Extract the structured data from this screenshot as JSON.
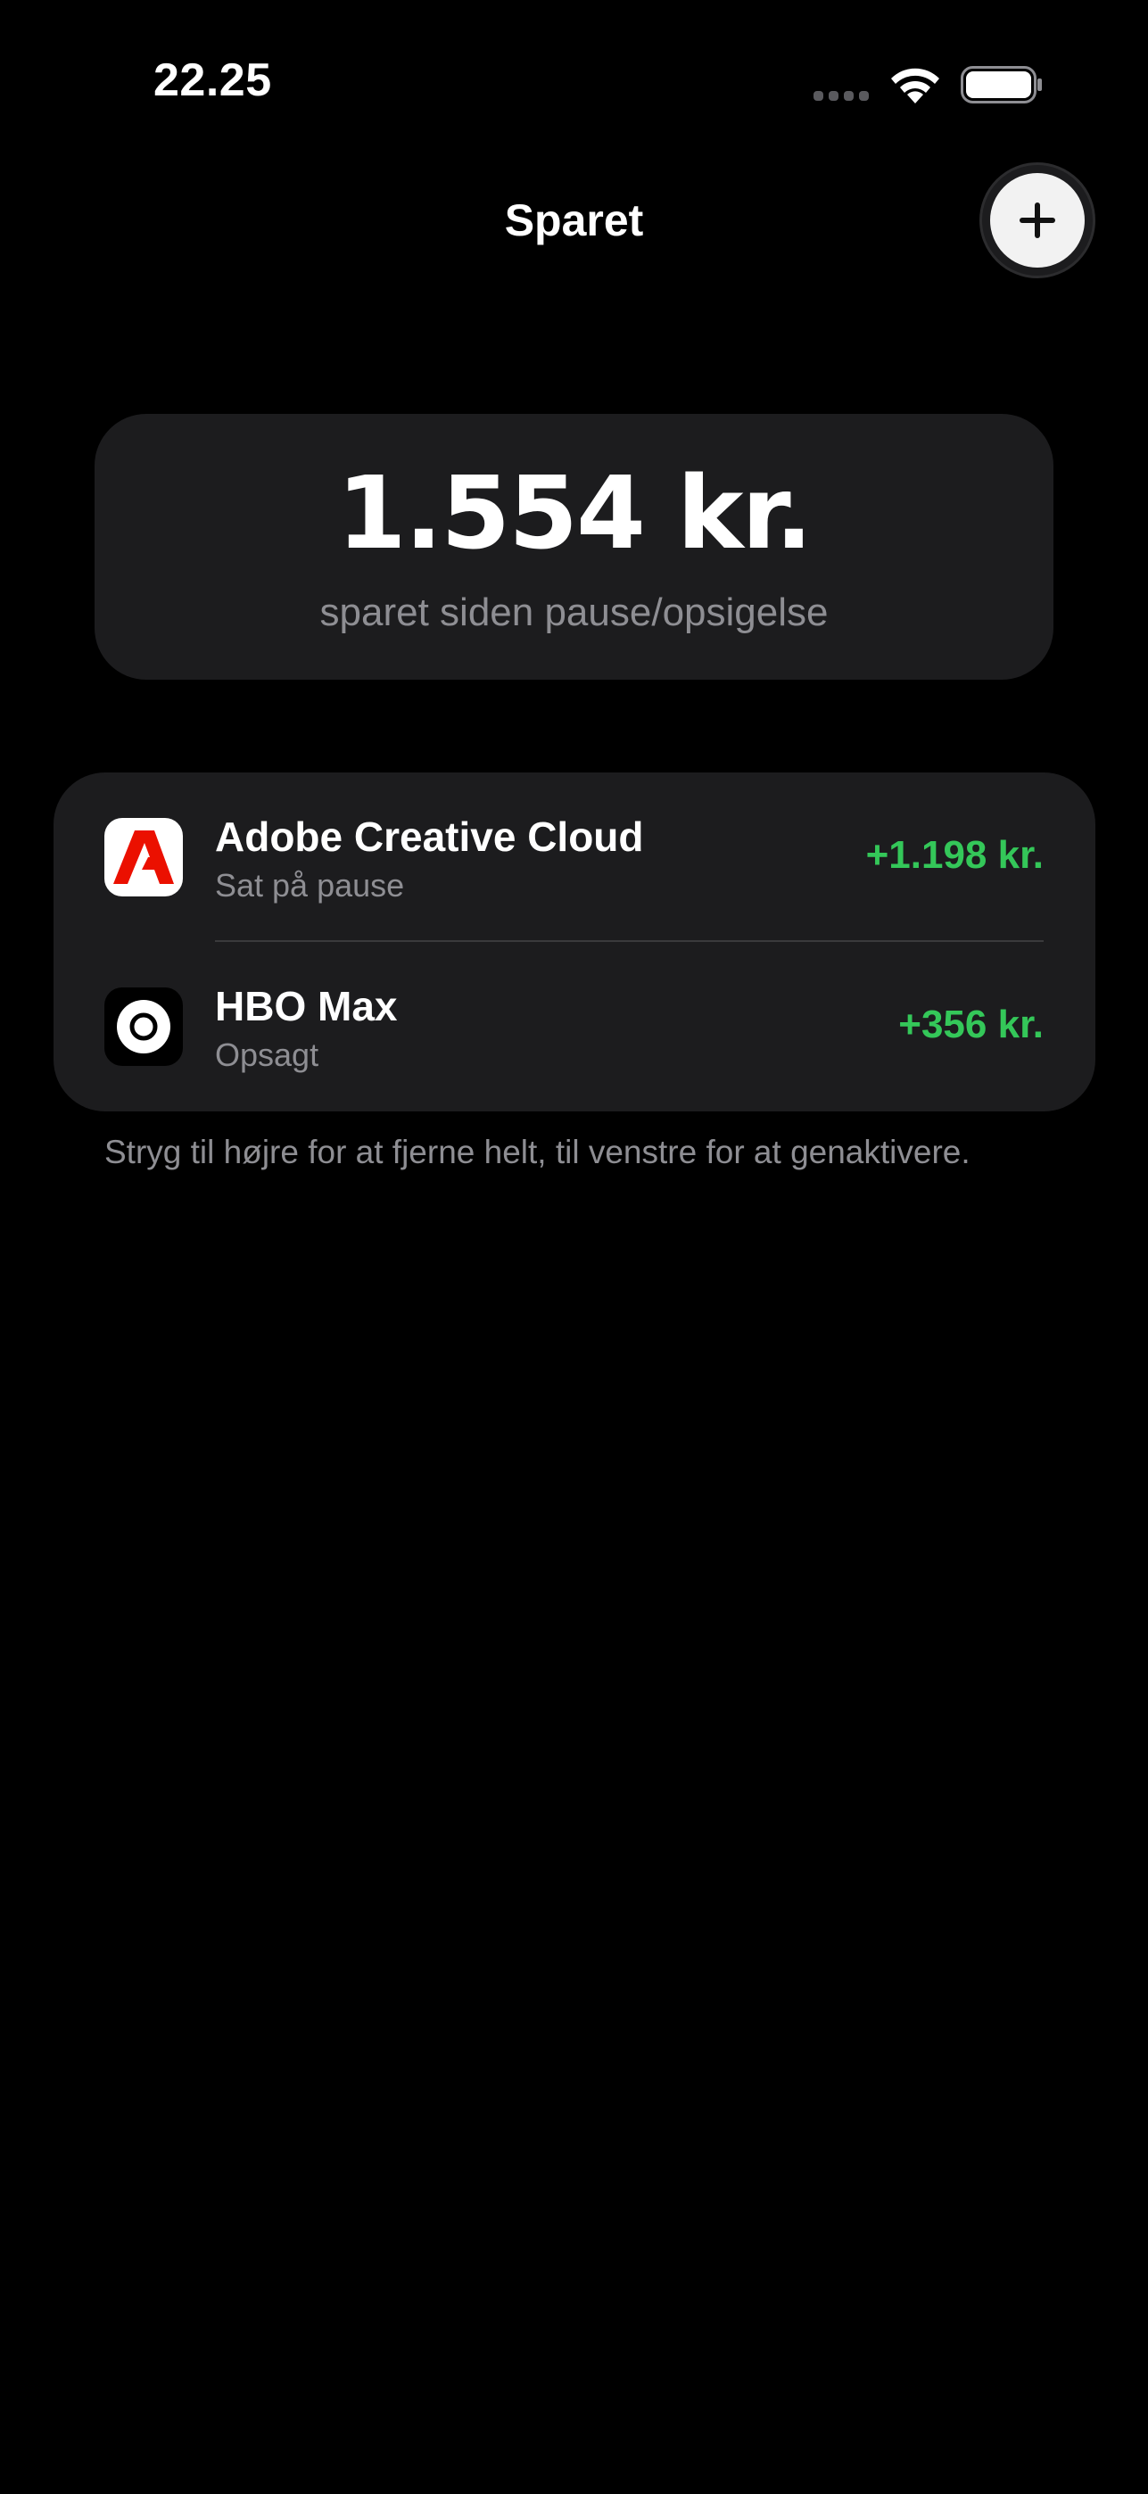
{
  "status_bar": {
    "time": "22.25"
  },
  "nav": {
    "title": "Sparet",
    "add_icon": "plus-icon"
  },
  "summary": {
    "amount": "1.554 kr.",
    "caption": "sparet siden pause/opsigelse"
  },
  "subscriptions": [
    {
      "name": "Adobe Creative Cloud",
      "status": "Sat på pause",
      "amount": "+1.198 kr.",
      "icon": "adobe-icon"
    },
    {
      "name": "HBO Max",
      "status": "Opsagt",
      "amount": "+356 kr.",
      "icon": "hbo-max-icon"
    }
  ],
  "hint": "Stryg til højre for at fjerne helt, til venstre for at genaktivere.",
  "colors": {
    "background": "#000000",
    "card": "#1c1c1e",
    "secondary_text": "#8e8e93",
    "positive": "#34c759",
    "adobe_red": "#eb1000"
  }
}
